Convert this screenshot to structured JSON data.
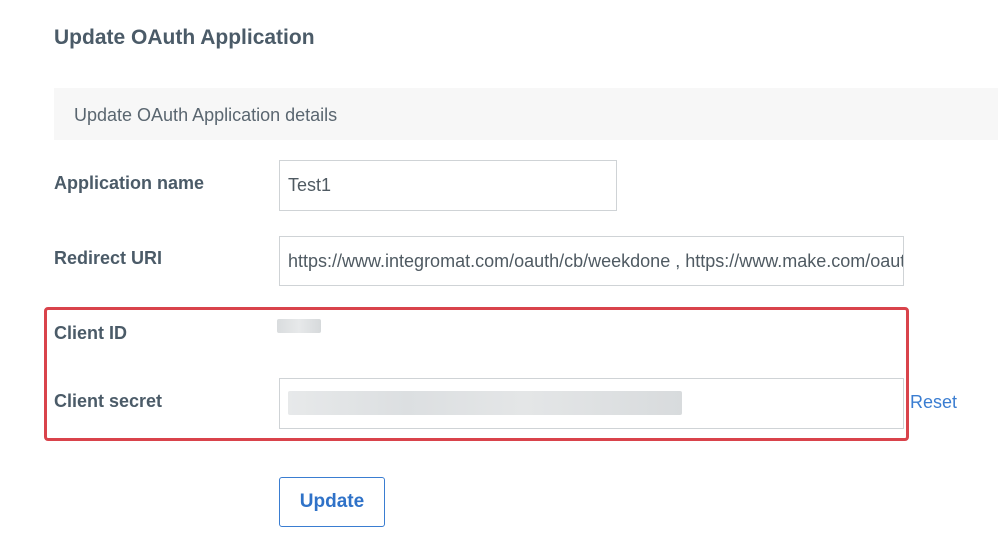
{
  "page": {
    "title": "Update OAuth Application"
  },
  "panel": {
    "header": "Update OAuth Application details"
  },
  "form": {
    "application_name": {
      "label": "Application name",
      "value": "Test1"
    },
    "redirect_uri": {
      "label": "Redirect URI",
      "value": "https://www.integromat.com/oauth/cb/weekdone , https://www.make.com/oauth/cb/weekdone"
    },
    "client_id": {
      "label": "Client ID"
    },
    "client_secret": {
      "label": "Client secret",
      "reset_label": "Reset"
    },
    "submit_label": "Update"
  },
  "colors": {
    "highlight_border": "#d9434b",
    "link": "#3a7dd1",
    "label_text": "#4b5b68"
  }
}
